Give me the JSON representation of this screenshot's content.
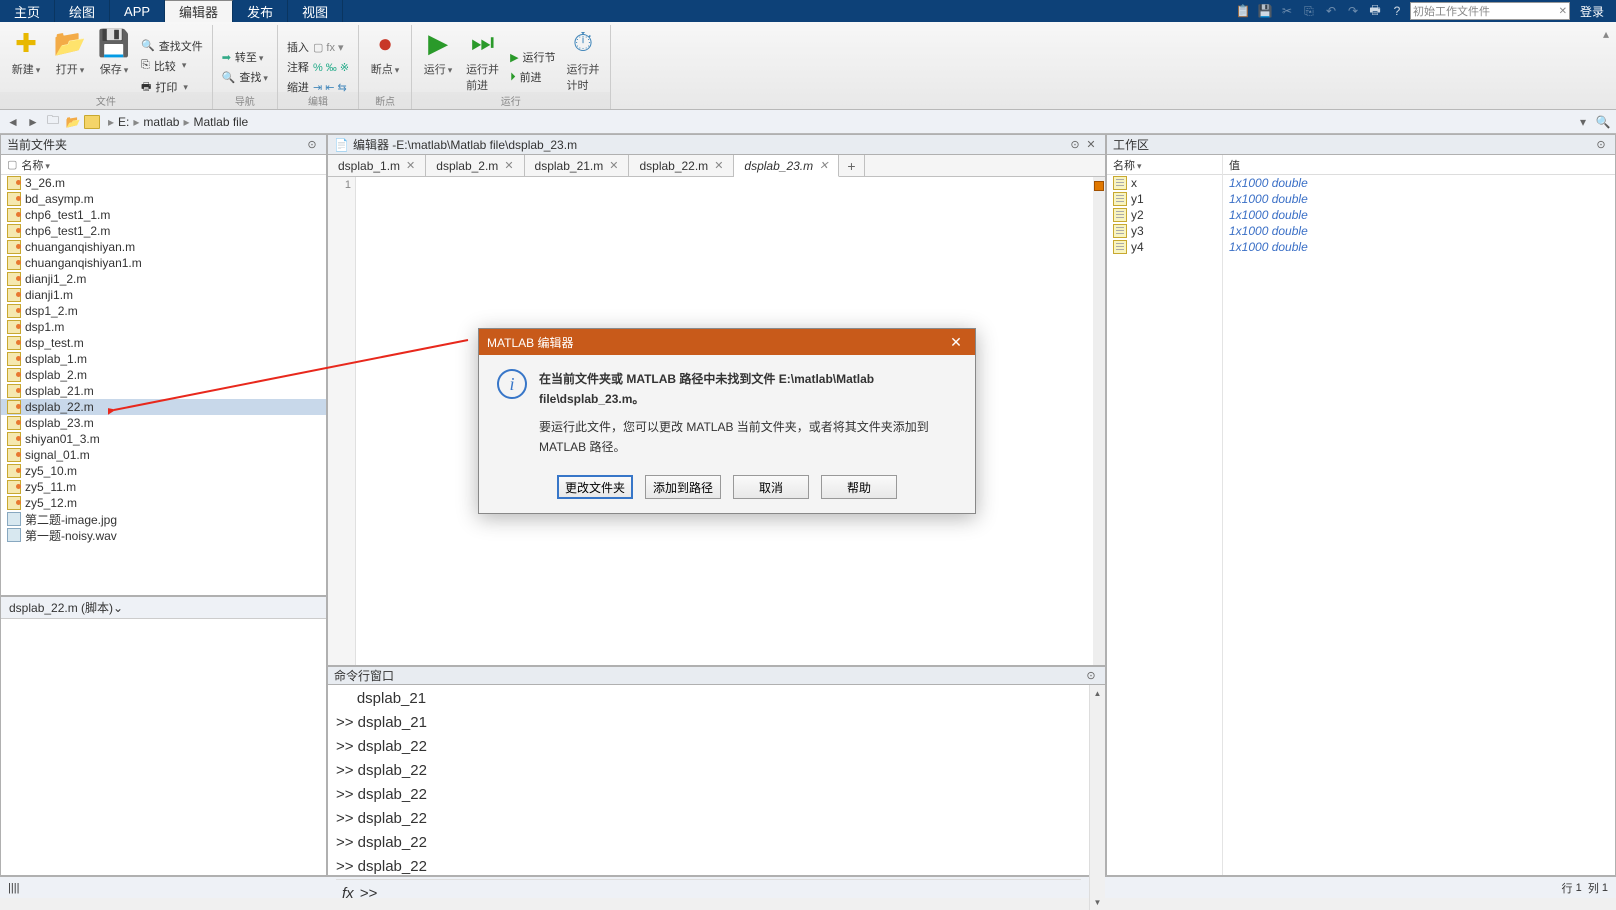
{
  "tabs": {
    "items": [
      {
        "l": "主页"
      },
      {
        "l": "绘图"
      },
      {
        "l": "APP"
      },
      {
        "l": "编辑器",
        "active": true
      },
      {
        "l": "发布"
      },
      {
        "l": "视图"
      }
    ],
    "search_placeholder": "初始工作文件件",
    "login": "登录"
  },
  "toolstrip": {
    "new": "新建",
    "open": "打开",
    "save": "保存",
    "findfiles": "查找文件",
    "compare": "比较",
    "print": "打印",
    "insert": "插入",
    "comment": "注释",
    "indent": "缩进",
    "goto": "转至",
    "breakpoint": "断点",
    "run": "运行",
    "runadvance": "运行并\n前进",
    "runsection": "运行节",
    "advance": "前进",
    "runtime": "运行并\n计时",
    "grp_file": "文件",
    "grp_nav": "导航",
    "grp_edit": "编辑",
    "grp_bp": "断点",
    "grp_run": "运行"
  },
  "address": {
    "drive": "E:",
    "segs": [
      "matlab",
      "Matlab file"
    ]
  },
  "folder": {
    "title": "当前文件夹",
    "col": "名称",
    "files": [
      {
        "n": "3_26.m",
        "t": "m"
      },
      {
        "n": "bd_asymp.m",
        "t": "m"
      },
      {
        "n": "chp6_test1_1.m",
        "t": "m"
      },
      {
        "n": "chp6_test1_2.m",
        "t": "m"
      },
      {
        "n": "chuanganqishiyan.m",
        "t": "m"
      },
      {
        "n": "chuanganqishiyan1.m",
        "t": "m"
      },
      {
        "n": "dianji1_2.m",
        "t": "m"
      },
      {
        "n": "dianji1.m",
        "t": "m"
      },
      {
        "n": "dsp1_2.m",
        "t": "m"
      },
      {
        "n": "dsp1.m",
        "t": "m"
      },
      {
        "n": "dsp_test.m",
        "t": "m"
      },
      {
        "n": "dsplab_1.m",
        "t": "m"
      },
      {
        "n": "dsplab_2.m",
        "t": "m"
      },
      {
        "n": "dsplab_21.m",
        "t": "m"
      },
      {
        "n": "dsplab_22.m",
        "t": "m",
        "sel": true
      },
      {
        "n": "dsplab_23.m",
        "t": "m"
      },
      {
        "n": "shiyan01_3.m",
        "t": "m"
      },
      {
        "n": "signal_01.m",
        "t": "m"
      },
      {
        "n": "zy5_10.m",
        "t": "m"
      },
      {
        "n": "zy5_11.m",
        "t": "m"
      },
      {
        "n": "zy5_12.m",
        "t": "m"
      },
      {
        "n": "第二题-image.jpg",
        "t": "jpg"
      },
      {
        "n": "第一题-noisy.wav",
        "t": "wav"
      }
    ],
    "detail": "dsplab_22.m  (脚本)"
  },
  "editor": {
    "title_prefix": "编辑器 - ",
    "path": "E:\\matlab\\Matlab file\\dsplab_23.m",
    "tabs": [
      {
        "l": "dsplab_1.m"
      },
      {
        "l": "dsplab_2.m"
      },
      {
        "l": "dsplab_21.m"
      },
      {
        "l": "dsplab_22.m"
      },
      {
        "l": "dsplab_23.m",
        "active": true
      }
    ],
    "line1": "1"
  },
  "cmd": {
    "title": "命令行窗口",
    "lines": [
      "     dsplab_21",
      ">> dsplab_21",
      ">> dsplab_22",
      ">> dsplab_22",
      ">> dsplab_22",
      ">> dsplab_22",
      ">> dsplab_22",
      ">> dsplab_22"
    ],
    "prompt": ">> "
  },
  "workspace": {
    "title": "工作区",
    "col_name": "名称",
    "col_val": "值",
    "vars": [
      {
        "n": "x",
        "v": "1x1000 double"
      },
      {
        "n": "y1",
        "v": "1x1000 double"
      },
      {
        "n": "y2",
        "v": "1x1000 double"
      },
      {
        "n": "y3",
        "v": "1x1000 double"
      },
      {
        "n": "y4",
        "v": "1x1000 double"
      }
    ]
  },
  "dialog": {
    "title": "MATLAB 编辑器",
    "line1": "在当前文件夹或 MATLAB 路径中未找到文件 E:\\matlab\\Matlab file\\dsplab_23.m。",
    "line2": "要运行此文件，您可以更改 MATLAB 当前文件夹，或者将其文件夹添加到 MATLAB 路径。",
    "btn_change": "更改文件夹",
    "btn_add": "添加到路径",
    "btn_cancel": "取消",
    "btn_help": "帮助"
  },
  "status": {
    "row": "行",
    "row_n": "1",
    "col": "列",
    "col_n": "1"
  }
}
